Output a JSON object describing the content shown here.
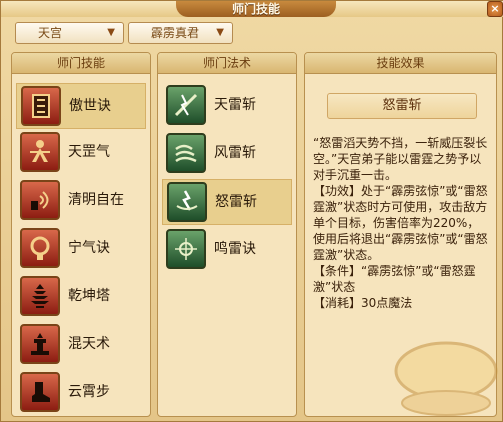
{
  "window": {
    "title": "师门技能",
    "close_glyph": "×"
  },
  "filters": {
    "sect": "天宫",
    "master": "霹雳真君",
    "arrow": "▼"
  },
  "panels": {
    "skills_header": "师门技能",
    "spells_header": "师门法术",
    "effect_header": "技能效果"
  },
  "skills": [
    {
      "label": "傲世诀",
      "icon": "scroll-icon",
      "selected": true
    },
    {
      "label": "天罡气",
      "icon": "figure-icon",
      "selected": false
    },
    {
      "label": "清明自在",
      "icon": "signal-icon",
      "selected": false
    },
    {
      "label": "宁气诀",
      "icon": "mirror-icon",
      "selected": false
    },
    {
      "label": "乾坤塔",
      "icon": "pagoda-icon",
      "selected": false
    },
    {
      "label": "混天术",
      "icon": "tower-icon",
      "selected": false
    },
    {
      "label": "云霄步",
      "icon": "boot-icon",
      "selected": false
    }
  ],
  "spells": [
    {
      "label": "天雷斩",
      "icon": "thunder-slash-icon",
      "selected": false
    },
    {
      "label": "风雷斩",
      "icon": "wind-thunder-icon",
      "selected": false
    },
    {
      "label": "怒雷斩",
      "icon": "rage-thunder-icon",
      "selected": true
    },
    {
      "label": "鸣雷诀",
      "icon": "thunder-orb-icon",
      "selected": false
    }
  ],
  "effect": {
    "name": "怒雷斩",
    "lines": [
      "“怒雷滔天势不挡，一斩威压裂长空。”天宫弟子能以雷霆之势予以对手沉重一击。",
      "【功效】处于“霹雳弦惊”或“雷怒霆激”状态时方可使用，攻击敌方单个目标，伤害倍率为220%，使用后将退出“霹雳弦惊”或“雷怒霆激”状态。",
      "【条件】“霹雳弦惊”或“雷怒霆激”状态",
      "【消耗】30点魔法"
    ]
  }
}
